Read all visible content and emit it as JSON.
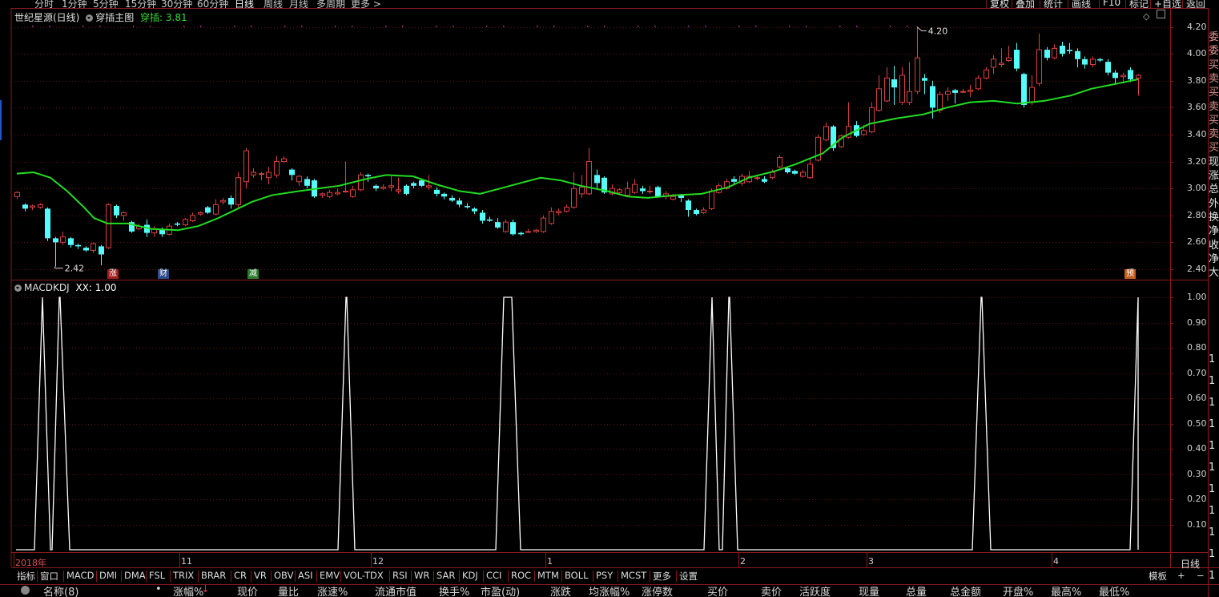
{
  "toolbar": {
    "timeframes": [
      "分时",
      "1分钟",
      "5分钟",
      "15分钟",
      "30分钟",
      "60分钟",
      "日线",
      "周线",
      "月线",
      "多周期",
      "更多 >"
    ],
    "active_timeframe": "日线",
    "right_buttons": [
      "复权",
      "叠加",
      "统计",
      "画线",
      "F10",
      "标记",
      "+自选",
      "返回"
    ]
  },
  "main_chart": {
    "title": "世纪星源(日线)",
    "indicator_name": "穿插主图",
    "indicator_label": "穿插: 3.81",
    "y_ticks": [
      "4.20",
      "4.00",
      "3.80",
      "3.60",
      "3.40",
      "3.20",
      "3.00",
      "2.80",
      "2.60",
      "2.40"
    ],
    "high_label": "4.20",
    "low_label": "2.42",
    "markers": [
      {
        "text": "涨",
        "color": "#a02020"
      },
      {
        "text": "财",
        "color": "#2a4a8a"
      },
      {
        "text": "减",
        "color": "#2e7a2e"
      },
      {
        "text": "预",
        "color": "#c06020"
      }
    ]
  },
  "sub_chart": {
    "title": "MACDKDJ",
    "value_label": "XX: 1.00",
    "y_ticks": [
      "1.00",
      "0.90",
      "0.80",
      "0.70",
      "0.60",
      "0.50",
      "0.40",
      "0.30",
      "0.20",
      "0.10"
    ]
  },
  "date_axis": {
    "labels": [
      "2018年",
      "11",
      "12",
      "1",
      "2",
      "3",
      "4"
    ],
    "period": "日线"
  },
  "indicator_tabs": [
    "指标",
    "窗口",
    "MACD",
    "DMI",
    "DMA",
    "FSL",
    "TRIX",
    "BRAR",
    "CR",
    "VR",
    "OBV",
    "ASI",
    "EMV",
    "VOL-TDX",
    "RSI",
    "WR",
    "SAR",
    "KDJ",
    "CCI",
    "ROC",
    "MTM",
    "BOLL",
    "PSY",
    "MCST",
    "更多",
    "设置"
  ],
  "template_label": "模板",
  "template_buttons": [
    "+",
    "−"
  ],
  "column_headers": [
    "名称(8)",
    "•",
    "涨幅%",
    "现价",
    "量比",
    "涨速%",
    "流通市值",
    "换手%",
    "市盈(动)",
    "涨跌",
    "均涨幅%",
    "涨停数",
    "买价",
    "卖价",
    "活跃度",
    "现量",
    "总量",
    "总金额",
    "开盘%",
    "最高%",
    "最低%"
  ],
  "right_panel_chars": [
    "委",
    "委",
    "买",
    "卖",
    "买",
    "卖",
    "买",
    "卖",
    "买",
    "现",
    "涨",
    "总",
    "外",
    "换",
    "净",
    "收",
    "净",
    "大",
    "1",
    "1",
    "1",
    "1",
    "1",
    "1",
    "1",
    "1",
    "1",
    "1",
    "1"
  ],
  "colors": {
    "up": "#d84040",
    "down": "#54fcfc",
    "ma": "#22dd22",
    "grid": "#6a1010",
    "frame": "#8b1a1a",
    "signal": "#ffffff",
    "indicator_label": "#33dd33"
  },
  "chart_data": [
    {
      "type": "candlestick",
      "title": "世纪星源(日线)",
      "ylim": [
        2.35,
        4.25
      ],
      "candles": [
        [
          2.94,
          2.97,
          2.98,
          2.92
        ],
        [
          2.88,
          2.85,
          2.89,
          2.83
        ],
        [
          2.86,
          2.87,
          2.88,
          2.84
        ],
        [
          2.86,
          2.88,
          2.89,
          2.85
        ],
        [
          2.85,
          2.63,
          2.86,
          2.61
        ],
        [
          2.63,
          2.6,
          2.64,
          2.42
        ],
        [
          2.6,
          2.64,
          2.68,
          2.58
        ],
        [
          2.63,
          2.58,
          2.64,
          2.56
        ],
        [
          2.58,
          2.57,
          2.59,
          2.55
        ],
        [
          2.56,
          2.54,
          2.57,
          2.53
        ],
        [
          2.54,
          2.59,
          2.6,
          2.52
        ],
        [
          2.57,
          2.51,
          2.58,
          2.43
        ],
        [
          2.56,
          2.88,
          2.89,
          2.55
        ],
        [
          2.87,
          2.8,
          2.88,
          2.78
        ],
        [
          2.8,
          2.82,
          2.83,
          2.76
        ],
        [
          2.75,
          2.68,
          2.76,
          2.67
        ],
        [
          2.7,
          2.72,
          2.74,
          2.69
        ],
        [
          2.73,
          2.67,
          2.77,
          2.64
        ],
        [
          2.67,
          2.7,
          2.72,
          2.64
        ],
        [
          2.7,
          2.66,
          2.71,
          2.64
        ],
        [
          2.66,
          2.72,
          2.74,
          2.65
        ],
        [
          2.74,
          2.73,
          2.75,
          2.72
        ],
        [
          2.73,
          2.77,
          2.78,
          2.72
        ],
        [
          2.76,
          2.8,
          2.82,
          2.75
        ],
        [
          2.81,
          2.82,
          2.83,
          2.8
        ],
        [
          2.86,
          2.82,
          2.87,
          2.81
        ],
        [
          2.81,
          2.88,
          2.92,
          2.8
        ],
        [
          2.9,
          2.91,
          2.93,
          2.88
        ],
        [
          2.93,
          2.88,
          2.95,
          2.85
        ],
        [
          2.88,
          3.08,
          3.12,
          2.85
        ],
        [
          3.05,
          3.28,
          3.3,
          3.0
        ],
        [
          3.1,
          3.12,
          3.15,
          3.08
        ],
        [
          3.11,
          3.11,
          3.12,
          3.06
        ],
        [
          3.08,
          3.12,
          3.16,
          3.03
        ],
        [
          3.1,
          3.2,
          3.24,
          3.08
        ],
        [
          3.2,
          3.22,
          3.24,
          3.19
        ],
        [
          3.14,
          3.1,
          3.15,
          3.06
        ],
        [
          3.05,
          3.09,
          3.1,
          3.02
        ],
        [
          3.07,
          3.02,
          3.09,
          3.0
        ],
        [
          3.06,
          2.94,
          3.07,
          2.93
        ],
        [
          2.95,
          2.96,
          2.97,
          2.93
        ],
        [
          2.94,
          2.97,
          2.99,
          2.93
        ],
        [
          2.96,
          2.97,
          3.0,
          2.95
        ],
        [
          2.98,
          2.98,
          3.2,
          2.97
        ],
        [
          2.94,
          2.99,
          3.02,
          2.93
        ],
        [
          2.99,
          3.1,
          3.12,
          2.98
        ],
        [
          3.1,
          3.09,
          3.11,
          3.05
        ],
        [
          3.02,
          3.0,
          3.03,
          2.98
        ],
        [
          3.0,
          3.01,
          3.03,
          2.99
        ],
        [
          3.01,
          3.02,
          3.09,
          2.98
        ],
        [
          2.98,
          2.99,
          3.08,
          2.96
        ],
        [
          3.02,
          2.96,
          3.03,
          2.95
        ],
        [
          3.04,
          3.02,
          3.05,
          3.0
        ],
        [
          3.06,
          3.02,
          3.07,
          3.01
        ],
        [
          3.01,
          3.02,
          3.1,
          2.99
        ],
        [
          2.99,
          2.96,
          3.01,
          2.94
        ],
        [
          2.96,
          2.94,
          2.97,
          2.92
        ],
        [
          2.93,
          2.91,
          2.95,
          2.9
        ],
        [
          2.91,
          2.88,
          2.93,
          2.86
        ],
        [
          2.87,
          2.86,
          2.89,
          2.85
        ],
        [
          2.85,
          2.83,
          2.86,
          2.81
        ],
        [
          2.82,
          2.76,
          2.84,
          2.74
        ],
        [
          2.77,
          2.76,
          2.79,
          2.75
        ],
        [
          2.75,
          2.71,
          2.78,
          2.7
        ],
        [
          2.68,
          2.75,
          2.77,
          2.67
        ],
        [
          2.75,
          2.66,
          2.77,
          2.65
        ],
        [
          2.67,
          2.66,
          2.68,
          2.65
        ],
        [
          2.68,
          2.68,
          2.7,
          2.67
        ],
        [
          2.68,
          2.69,
          2.7,
          2.67
        ],
        [
          2.68,
          2.78,
          2.8,
          2.67
        ],
        [
          2.74,
          2.83,
          2.86,
          2.73
        ],
        [
          2.82,
          2.83,
          2.85,
          2.8
        ],
        [
          2.83,
          2.86,
          2.88,
          2.82
        ],
        [
          2.86,
          3.0,
          3.12,
          2.85
        ],
        [
          2.96,
          3.01,
          3.1,
          2.93
        ],
        [
          2.96,
          3.2,
          3.3,
          2.95
        ],
        [
          3.1,
          3.04,
          3.14,
          3.0
        ],
        [
          3.08,
          2.97,
          3.09,
          2.96
        ],
        [
          2.96,
          3.0,
          3.03,
          2.95
        ],
        [
          2.97,
          2.99,
          3.0,
          2.95
        ],
        [
          2.95,
          3.0,
          3.05,
          2.94
        ],
        [
          2.97,
          3.03,
          3.07,
          2.96
        ],
        [
          3.0,
          2.98,
          3.02,
          2.96
        ],
        [
          2.98,
          2.98,
          3.02,
          2.96
        ],
        [
          3.01,
          2.94,
          3.02,
          2.93
        ],
        [
          2.94,
          2.96,
          2.98,
          2.92
        ],
        [
          2.92,
          2.94,
          2.96,
          2.91
        ],
        [
          2.95,
          2.93,
          2.96,
          2.9
        ],
        [
          2.91,
          2.84,
          2.92,
          2.79
        ],
        [
          2.84,
          2.81,
          2.85,
          2.8
        ],
        [
          2.82,
          2.84,
          2.86,
          2.81
        ],
        [
          2.85,
          2.98,
          3.0,
          2.84
        ],
        [
          2.97,
          3.02,
          3.04,
          2.96
        ],
        [
          3.0,
          3.05,
          3.07,
          2.99
        ],
        [
          3.07,
          3.05,
          3.09,
          3.03
        ],
        [
          3.04,
          3.09,
          3.11,
          3.02
        ],
        [
          3.05,
          3.09,
          3.13,
          3.04
        ],
        [
          3.08,
          3.08,
          3.1,
          3.06
        ],
        [
          3.07,
          3.05,
          3.09,
          3.04
        ],
        [
          3.08,
          3.12,
          3.14,
          3.07
        ],
        [
          3.16,
          3.23,
          3.25,
          3.15
        ],
        [
          3.15,
          3.12,
          3.16,
          3.11
        ],
        [
          3.13,
          3.11,
          3.14,
          3.1
        ],
        [
          3.09,
          3.12,
          3.14,
          3.08
        ],
        [
          3.08,
          3.18,
          3.22,
          3.07
        ],
        [
          3.21,
          3.38,
          3.4,
          3.2
        ],
        [
          3.36,
          3.46,
          3.49,
          3.35
        ],
        [
          3.46,
          3.3,
          3.47,
          3.28
        ],
        [
          3.31,
          3.39,
          3.4,
          3.3
        ],
        [
          3.38,
          3.46,
          3.64,
          3.37
        ],
        [
          3.47,
          3.39,
          3.5,
          3.38
        ],
        [
          3.4,
          3.43,
          3.47,
          3.39
        ],
        [
          3.42,
          3.6,
          3.64,
          3.41
        ],
        [
          3.58,
          3.74,
          3.84,
          3.57
        ],
        [
          3.65,
          3.82,
          3.9,
          3.64
        ],
        [
          3.81,
          3.75,
          3.91,
          3.62
        ],
        [
          3.64,
          3.84,
          3.9,
          3.62
        ],
        [
          3.64,
          3.72,
          3.94,
          3.62
        ],
        [
          3.72,
          3.97,
          4.2,
          3.7
        ],
        [
          3.82,
          3.8,
          3.85,
          3.7
        ],
        [
          3.76,
          3.6,
          3.8,
          3.52
        ],
        [
          3.58,
          3.7,
          3.72,
          3.56
        ],
        [
          3.7,
          3.72,
          3.75,
          3.65
        ],
        [
          3.73,
          3.71,
          3.74,
          3.63
        ],
        [
          3.72,
          3.72,
          3.74,
          3.71
        ],
        [
          3.72,
          3.73,
          3.77,
          3.68
        ],
        [
          3.74,
          3.82,
          3.84,
          3.73
        ],
        [
          3.82,
          3.88,
          3.9,
          3.81
        ],
        [
          3.9,
          3.96,
          3.99,
          3.85
        ],
        [
          3.92,
          3.93,
          4.04,
          3.9
        ],
        [
          3.95,
          3.97,
          4.06,
          3.94
        ],
        [
          4.03,
          3.89,
          4.08,
          3.87
        ],
        [
          3.85,
          3.62,
          3.86,
          3.6
        ],
        [
          3.64,
          3.75,
          3.84,
          3.62
        ],
        [
          3.78,
          4.03,
          4.15,
          3.76
        ],
        [
          4.03,
          3.97,
          4.05,
          3.95
        ],
        [
          3.97,
          4.04,
          4.07,
          3.96
        ],
        [
          4.06,
          4.0,
          4.09,
          3.98
        ],
        [
          4.03,
          4.02,
          4.08,
          4.0
        ],
        [
          4.02,
          3.96,
          4.04,
          3.9
        ],
        [
          3.96,
          3.92,
          3.98,
          3.89
        ],
        [
          3.92,
          3.96,
          3.98,
          3.9
        ],
        [
          3.96,
          3.95,
          3.97,
          3.94
        ],
        [
          3.94,
          3.86,
          3.96,
          3.84
        ],
        [
          3.86,
          3.82,
          3.88,
          3.78
        ],
        [
          3.83,
          3.84,
          3.86,
          3.78
        ],
        [
          3.88,
          3.81,
          3.9,
          3.79
        ],
        [
          3.82,
          3.84,
          3.85,
          3.69
        ]
      ],
      "ma": [
        [
          0,
          3.11
        ],
        [
          5,
          3.12
        ],
        [
          10,
          3.08
        ],
        [
          15,
          2.98
        ],
        [
          20,
          2.86
        ],
        [
          23,
          2.78
        ],
        [
          27,
          2.74
        ],
        [
          33,
          2.74
        ],
        [
          40,
          2.7
        ],
        [
          48,
          2.69
        ],
        [
          54,
          2.72
        ],
        [
          60,
          2.78
        ],
        [
          65,
          2.84
        ],
        [
          70,
          2.9
        ],
        [
          76,
          2.95
        ],
        [
          84,
          2.98
        ],
        [
          90,
          3.0
        ],
        [
          96,
          3.02
        ],
        [
          104,
          3.07
        ],
        [
          110,
          3.1
        ],
        [
          118,
          3.09
        ],
        [
          125,
          3.03
        ],
        [
          132,
          2.98
        ],
        [
          138,
          2.96
        ],
        [
          144,
          3.0
        ],
        [
          150,
          3.04
        ],
        [
          156,
          3.08
        ],
        [
          162,
          3.06
        ],
        [
          168,
          3.02
        ],
        [
          176,
          2.98
        ],
        [
          182,
          2.94
        ],
        [
          188,
          2.93
        ],
        [
          196,
          2.95
        ],
        [
          204,
          2.96
        ],
        [
          212,
          3.01
        ],
        [
          218,
          3.08
        ],
        [
          226,
          3.13
        ],
        [
          232,
          3.18
        ],
        [
          240,
          3.26
        ],
        [
          246,
          3.38
        ],
        [
          254,
          3.48
        ],
        [
          262,
          3.52
        ],
        [
          270,
          3.55
        ],
        [
          277,
          3.6
        ],
        [
          284,
          3.64
        ],
        [
          291,
          3.65
        ],
        [
          298,
          3.63
        ],
        [
          306,
          3.65
        ],
        [
          314,
          3.69
        ],
        [
          320,
          3.74
        ],
        [
          328,
          3.78
        ],
        [
          334,
          3.81
        ]
      ],
      "ma_label": "穿插: 3.81",
      "high": 4.2,
      "low": 2.42
    },
    {
      "type": "line",
      "title": "MACDKDJ",
      "series_label": "XX: 1.00",
      "ylim": [
        0,
        1.0
      ],
      "peaks": [
        {
          "rise": 43,
          "top": [
            53,
            53
          ],
          "fall": 63
        },
        {
          "rise": 65,
          "top": [
            74,
            75
          ],
          "fall": 87
        },
        {
          "rise": 422,
          "top": [
            432,
            433
          ],
          "fall": 443
        },
        {
          "rise": 619,
          "top": [
            629,
            639
          ],
          "fall": 650
        },
        {
          "rise": 879,
          "top": [
            889,
            889
          ],
          "fall": 898
        },
        {
          "rise": 902,
          "top": [
            910,
            911
          ],
          "fall": 921
        },
        {
          "rise": 1214,
          "top": [
            1225,
            1226
          ],
          "fall": 1237
        },
        {
          "rise": 1411,
          "top": [
            1421,
            1421
          ],
          "fall": 1421
        }
      ]
    }
  ]
}
